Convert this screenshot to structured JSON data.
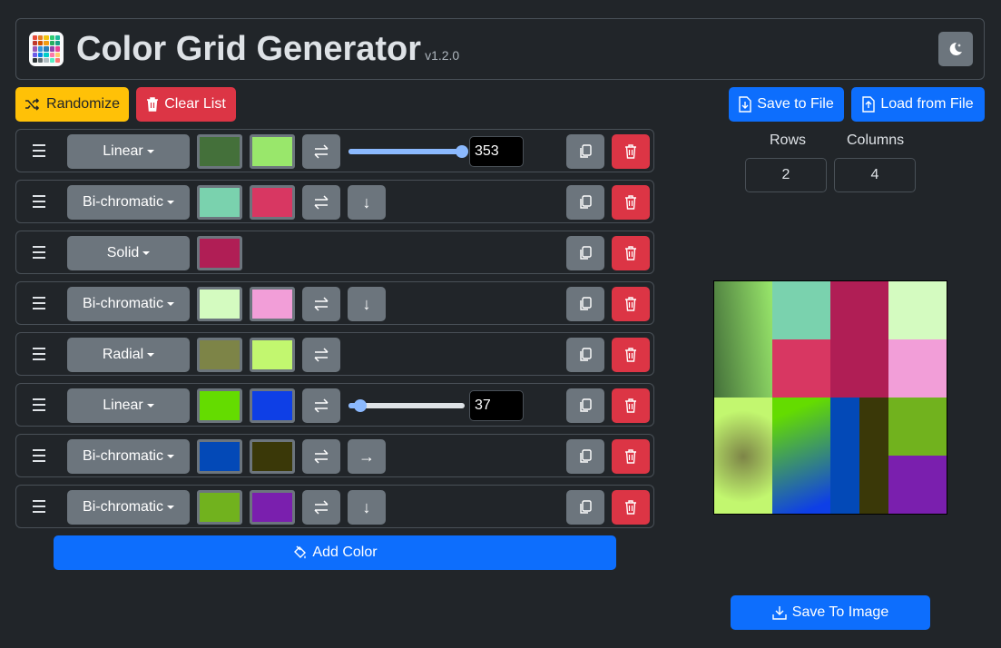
{
  "header": {
    "title": "Color Grid Generator",
    "version": "v1.2.0",
    "logo_icon": "palette-grid-icon",
    "theme_icon": "moon-stars-icon"
  },
  "toolbar": {
    "randomize_label": "Randomize",
    "clear_label": "Clear List",
    "save_file_label": "Save to File",
    "load_file_label": "Load from File"
  },
  "grid": {
    "rows_label": "Rows",
    "columns_label": "Columns",
    "rows_value": "2",
    "columns_value": "4"
  },
  "colors": [
    {
      "type": "Linear",
      "color1": "#44703a",
      "color2": "#99e76b",
      "angle": "353",
      "angle_fraction": 0.98
    },
    {
      "type": "Bi-chromatic",
      "color1": "#7ad2ae",
      "color2": "#d83762",
      "direction": "↓"
    },
    {
      "type": "Solid",
      "color1": "#b01e55"
    },
    {
      "type": "Bi-chromatic",
      "color1": "#d4fbc0",
      "color2": "#f29ed8",
      "direction": "↓"
    },
    {
      "type": "Radial",
      "color1": "#7d8447",
      "color2": "#c2f76f"
    },
    {
      "type": "Linear",
      "color1": "#64dc00",
      "color2": "#0e3fe6",
      "angle": "37",
      "angle_fraction": 0.1
    },
    {
      "type": "Bi-chromatic",
      "color1": "#0349b7",
      "color2": "#3a3808",
      "direction": "→"
    },
    {
      "type": "Bi-chromatic",
      "color1": "#71b21e",
      "color2": "#7a1fae",
      "direction": "↓"
    }
  ],
  "add_color_label": "Add Color",
  "save_image_label": "Save To Image",
  "accent": {
    "primary": "#0d6efd",
    "warning": "#ffc107",
    "danger": "#dc3545",
    "secondary": "#6c757d"
  }
}
